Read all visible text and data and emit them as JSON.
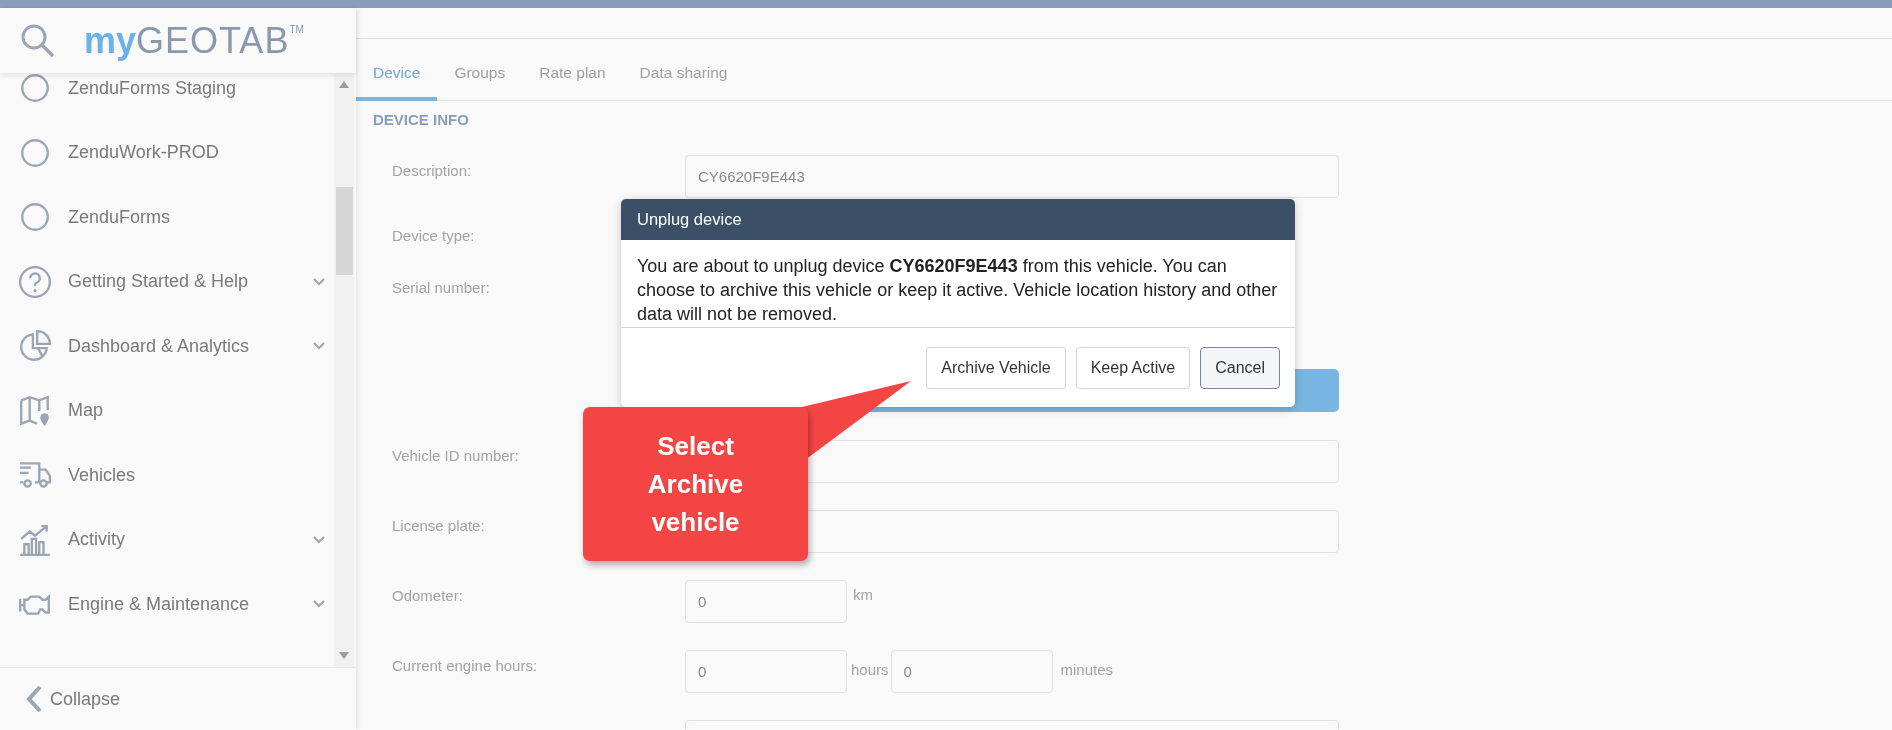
{
  "logo": {
    "prefix": "my",
    "name": "GEOTAB",
    "mark": "TM"
  },
  "sidebar": {
    "items": [
      {
        "label": "ZenduForms Staging",
        "expandable": false
      },
      {
        "label": "ZenduWork-PROD",
        "expandable": false
      },
      {
        "label": "ZenduForms",
        "expandable": false
      },
      {
        "label": "Getting Started & Help",
        "expandable": true
      },
      {
        "label": "Dashboard & Analytics",
        "expandable": true
      },
      {
        "label": "Map",
        "expandable": false
      },
      {
        "label": "Vehicles",
        "expandable": false
      },
      {
        "label": "Activity",
        "expandable": true
      },
      {
        "label": "Engine & Maintenance",
        "expandable": true
      }
    ],
    "collapse": "Collapse"
  },
  "tabs": [
    {
      "label": "Device",
      "selected": true
    },
    {
      "label": "Groups",
      "selected": false
    },
    {
      "label": "Rate plan",
      "selected": false
    },
    {
      "label": "Data sharing",
      "selected": false
    }
  ],
  "section_title": "DEVICE INFO",
  "form": [
    {
      "kind": "text",
      "label": "Description:",
      "value": "CY6620F9E443"
    },
    {
      "kind": "label",
      "label": "Device type:"
    },
    {
      "kind": "label",
      "label": "Serial number:"
    },
    {
      "kind": "button"
    },
    {
      "kind": "text",
      "label": "Vehicle ID number:"
    },
    {
      "kind": "text",
      "label": "License plate:"
    },
    {
      "kind": "unit",
      "label": "Odometer:",
      "value": "0",
      "unit": "km"
    },
    {
      "kind": "hours",
      "label": "Current engine hours:",
      "value": "0",
      "unit": "hours",
      "value2": "0",
      "unit2": "minutes"
    },
    {
      "kind": "edge"
    }
  ],
  "dialog": {
    "title": "Unplug device",
    "message": "You are about to unplug device **CY6620F9E443** from this vehicle. You can choose to archive this vehicle or keep it active. Vehicle location history and other data will not be removed.",
    "buttons": [
      {
        "label": "Archive Vehicle",
        "kind": "plain"
      },
      {
        "label": "Keep Active",
        "kind": "plain"
      },
      {
        "label": "Cancel",
        "kind": "default"
      }
    ]
  },
  "callout": {
    "text": "Select Archive vehicle"
  }
}
